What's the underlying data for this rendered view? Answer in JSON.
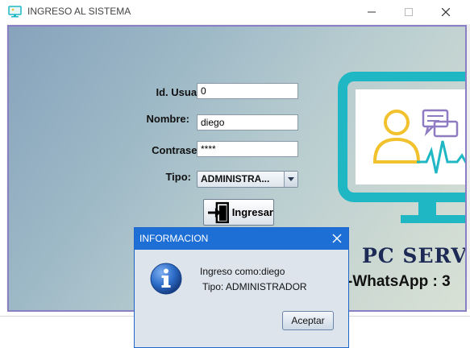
{
  "window": {
    "title": "INGRESO AL SISTEMA",
    "icon": "monitor-app-icon"
  },
  "form": {
    "id_label": "Id. Usuario:",
    "id_value": "0",
    "name_label": "Nombre:",
    "name_value": "diego",
    "password_label": "Contraseña:",
    "password_value": "****",
    "type_label": "Tipo:",
    "type_value": "ADMINISTRA...",
    "submit_label": "Ingresar",
    "submit_icon": "door-exit-icon"
  },
  "branding": {
    "name": "PC SERV",
    "whatsapp": "-WhatsApp : 3",
    "monitor_color": "#1fb7c4",
    "person_color": "#f2c12e",
    "chat_color": "#8e7bc2"
  },
  "dialog": {
    "title": "INFORMACION",
    "line1": "Ingreso como:diego",
    "line2": "Tipo: ADMINISTRADOR",
    "ok_label": "Aceptar",
    "icon": "info-icon",
    "title_bar_color": "#1d6fd6"
  }
}
